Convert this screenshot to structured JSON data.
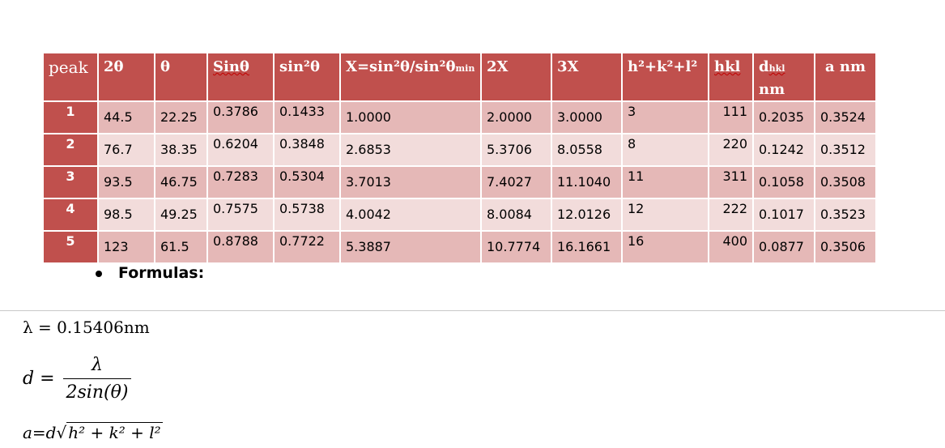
{
  "table": {
    "headers": [
      "peak",
      "2θ",
      "θ",
      "Sinθ",
      "sin²θ",
      "X=sin²θ/sin²θ",
      "min",
      "2X",
      "3X",
      "h²+k²+l²",
      "hkl",
      "d",
      "hkl",
      "nm",
      "a nm"
    ],
    "rows": [
      [
        "1",
        "44.5",
        "22.25",
        "0.3786",
        "0.1433",
        "1.0000",
        "2.0000",
        "3.0000",
        "3",
        "111",
        "0.2035",
        "0.3524"
      ],
      [
        "2",
        "76.7",
        "38.35",
        "0.6204",
        "0.3848",
        "2.6853",
        "5.3706",
        "8.0558",
        "8",
        "220",
        "0.1242",
        "0.3512"
      ],
      [
        "3",
        "93.5",
        "46.75",
        "0.7283",
        "0.5304",
        "3.7013",
        "7.4027",
        "11.1040",
        "11",
        "311",
        "0.1058",
        "0.3508"
      ],
      [
        "4",
        "98.5",
        "49.25",
        "0.7575",
        "0.5738",
        "4.0042",
        "8.0084",
        "12.0126",
        "12",
        "222",
        "0.1017",
        "0.3523"
      ],
      [
        "5",
        "123",
        "61.5",
        "0.8788",
        "0.7722",
        "5.3887",
        "10.7774",
        "16.1661",
        "16",
        "400",
        "0.0877",
        "0.3506"
      ]
    ]
  },
  "formulas": {
    "heading": "Formulas:",
    "lambda": "λ = 0.15406nm",
    "d_lhs": "d =",
    "d_num": "λ",
    "d_den": "2sin(θ)",
    "a_lhs": "a=d",
    "a_rad": "h² + k² + l²"
  },
  "colors": {
    "header": "#c0504d",
    "row_odd": "#e5b8b7",
    "row_even": "#f2dcdb"
  }
}
